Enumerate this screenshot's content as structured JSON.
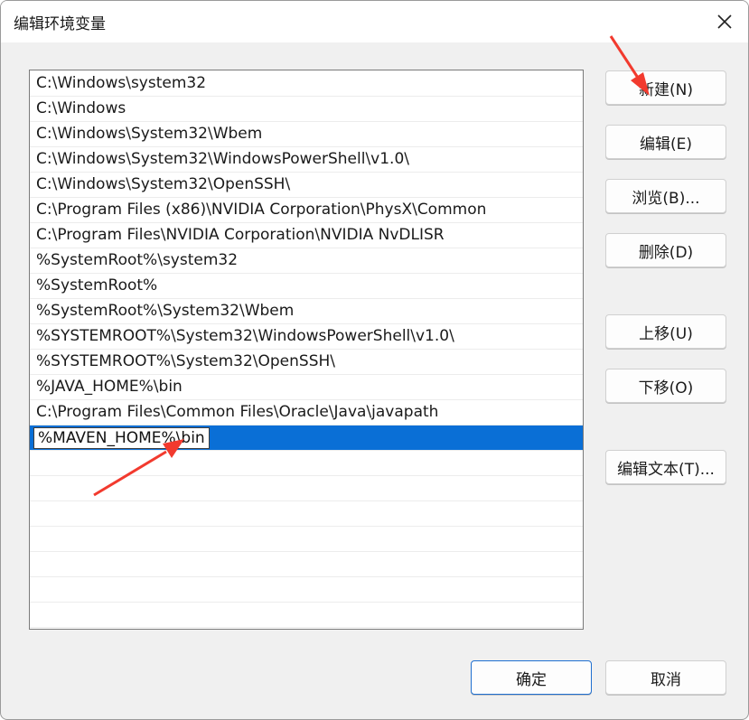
{
  "window": {
    "title": "编辑环境变量"
  },
  "path_entries": [
    "C:\\Windows\\system32",
    "C:\\Windows",
    "C:\\Windows\\System32\\Wbem",
    "C:\\Windows\\System32\\WindowsPowerShell\\v1.0\\",
    "C:\\Windows\\System32\\OpenSSH\\",
    "C:\\Program Files (x86)\\NVIDIA Corporation\\PhysX\\Common",
    "C:\\Program Files\\NVIDIA Corporation\\NVIDIA NvDLISR",
    "%SystemRoot%\\system32",
    "%SystemRoot%",
    "%SystemRoot%\\System32\\Wbem",
    "%SYSTEMROOT%\\System32\\WindowsPowerShell\\v1.0\\",
    "%SYSTEMROOT%\\System32\\OpenSSH\\",
    "%JAVA_HOME%\\bin",
    "C:\\Program Files\\Common Files\\Oracle\\Java\\javapath"
  ],
  "editing_entry": {
    "value": "%MAVEN_HOME%\\bin"
  },
  "buttons": {
    "new": "新建(N)",
    "edit": "编辑(E)",
    "browse": "浏览(B)...",
    "delete": "删除(D)",
    "move_up": "上移(U)",
    "move_down": "下移(O)",
    "edit_text": "编辑文本(T)...",
    "ok": "确定",
    "cancel": "取消"
  },
  "colors": {
    "selection": "#0a6fd6",
    "annotation_arrow": "#f23a2e",
    "primary_border": "#1f6fd0"
  },
  "icons": {
    "close": "close-icon",
    "annotation": "red-arrow-annotation"
  }
}
